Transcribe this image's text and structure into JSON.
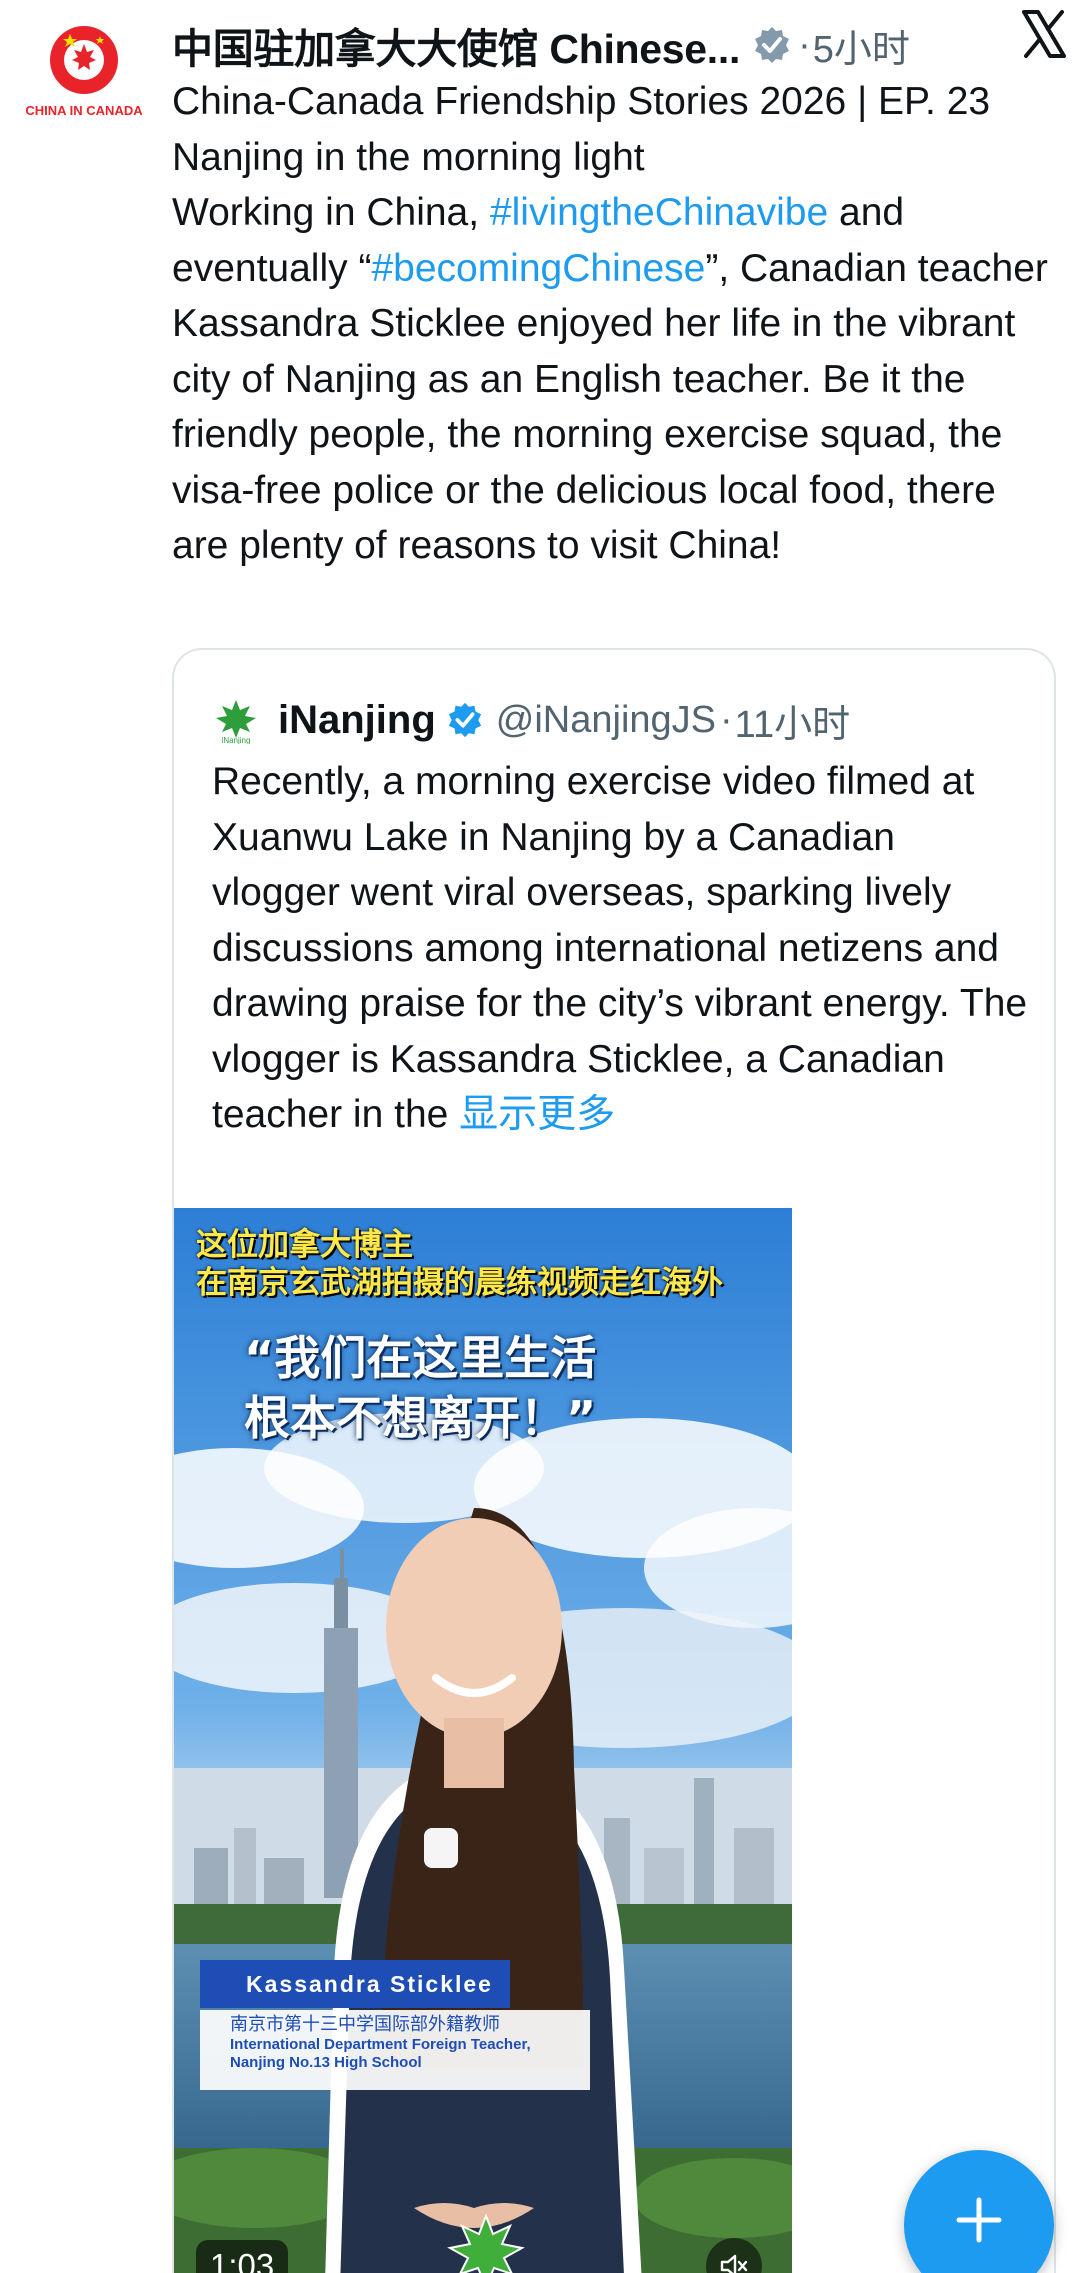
{
  "post": {
    "author": {
      "display_name": "中国驻加拿大大使馆 Chinese...",
      "avatar_caption": "CHINA IN CANADA",
      "verified_icon": "verified-badge-icon",
      "separator": "·",
      "timestamp": "5小时"
    },
    "menu_icon": "x-logo-icon",
    "text": {
      "t1": "China-Canada Friendship Stories 2026 | EP. 23 Nanjing in the morning light",
      "t2": "Working in China, ",
      "h1": "#livingtheChinavibe",
      "t3": " and eventually “",
      "h2": "#becomingChinese",
      "t4": "”, Canadian teacher Kassandra Sticklee enjoyed her life in the vibrant city of Nanjing as an English teacher. Be it the friendly people, the morning exercise squad, the visa-free police or the delicious local food, there are plenty of reasons to visit China!"
    }
  },
  "quote": {
    "author": {
      "name": "iNanjing",
      "handle": "@iNanjingJS",
      "separator": "·",
      "timestamp": "11小时"
    },
    "text": "Recently, a morning exercise video filmed at Xuanwu Lake in Nanjing by a Canadian vlogger went viral overseas, sparking lively discussions among international netizens and drawing praise for the city’s vibrant energy. The vlogger is Kassandra Sticklee, a Canadian teacher in the ",
    "show_more": "显示更多",
    "video": {
      "caption_line1": "这位加拿大博主",
      "caption_line2": "在南京玄武湖拍摄的晨练视频走红海外",
      "quote_line1": "“我们在这里生活",
      "quote_line2": "根本不想离开！”",
      "name_tag": "Kassandra Sticklee",
      "title_cn": "南京市第十三中学国际部外籍教师",
      "title_en1": "International Department Foreign Teacher,",
      "title_en2": "Nanjing No.13 High School",
      "duration": "1:03",
      "mute_icon": "speaker-muted-icon"
    }
  },
  "fab": {
    "icon": "plus-icon"
  },
  "colors": {
    "link": "#1d9bf0",
    "secondary_text": "#536471",
    "primary_text": "#0f1419",
    "fab": "#1d9bf0"
  }
}
